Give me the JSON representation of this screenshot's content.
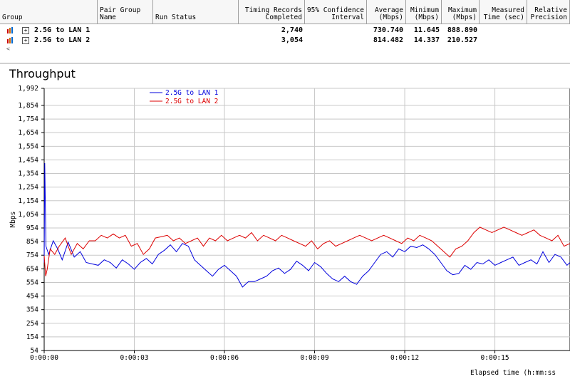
{
  "table": {
    "headers": [
      {
        "l1": "",
        "l2": "Group",
        "align": "left"
      },
      {
        "l1": "Pair Group",
        "l2": "Name",
        "align": "left"
      },
      {
        "l1": "",
        "l2": "Run Status",
        "align": "left"
      },
      {
        "l1": "Timing Records",
        "l2": "Completed",
        "align": "right"
      },
      {
        "l1": "95% Confidence",
        "l2": "Interval",
        "align": "right"
      },
      {
        "l1": "Average",
        "l2": "(Mbps)",
        "align": "right"
      },
      {
        "l1": "Minimum",
        "l2": "(Mbps)",
        "align": "right"
      },
      {
        "l1": "Maximum",
        "l2": "(Mbps)",
        "align": "right"
      },
      {
        "l1": "Measured",
        "l2": "Time (sec)",
        "align": "right"
      },
      {
        "l1": "Relative",
        "l2": "Precision",
        "align": "right"
      }
    ],
    "rows": [
      {
        "name": "2.5G to LAN 1",
        "records": "2,740",
        "average": "730.740",
        "minimum": "11.645",
        "maximum": "888.890"
      },
      {
        "name": "2.5G to LAN 2",
        "records": "3,054",
        "average": "814.482",
        "minimum": "14.337",
        "maximum": "210.527"
      }
    ],
    "expand_glyph": "+",
    "scroll_glyph": "<"
  },
  "chart_data": {
    "type": "line",
    "title": "Throughput",
    "ylabel": "Mbps",
    "xlabel": "Elapsed time (h:mm:ss",
    "ylim": [
      54,
      1992
    ],
    "yticks": [
      "1,992",
      "1,854",
      "1,754",
      "1,654",
      "1,554",
      "1,454",
      "1,354",
      "1,254",
      "1,154",
      "1,054",
      "954",
      "854",
      "754",
      "654",
      "554",
      "454",
      "354",
      "254",
      "154",
      "54"
    ],
    "ytick_values": [
      1992,
      1854,
      1754,
      1654,
      1554,
      1454,
      1354,
      1254,
      1154,
      1054,
      954,
      854,
      754,
      654,
      554,
      454,
      354,
      254,
      154,
      54
    ],
    "xlim": [
      0,
      17.5
    ],
    "xticks": [
      "0:00:00",
      "0:00:03",
      "0:00:06",
      "0:00:09",
      "0:00:12",
      "0:00:15"
    ],
    "xtick_values": [
      0,
      3,
      6,
      9,
      12,
      15
    ],
    "grid": true,
    "legend_position": "top-left",
    "series": [
      {
        "name": "2.5G to LAN 1",
        "color": "#0000dd",
        "x": [
          0,
          0.02,
          0.06,
          0.15,
          0.3,
          0.45,
          0.6,
          0.8,
          1.0,
          1.2,
          1.4,
          1.6,
          1.8,
          2.0,
          2.2,
          2.4,
          2.6,
          2.8,
          3.0,
          3.2,
          3.4,
          3.6,
          3.8,
          4.0,
          4.2,
          4.4,
          4.6,
          4.8,
          5.0,
          5.2,
          5.4,
          5.6,
          5.8,
          6.0,
          6.2,
          6.4,
          6.6,
          6.8,
          7.0,
          7.2,
          7.4,
          7.6,
          7.8,
          8.0,
          8.2,
          8.4,
          8.6,
          8.8,
          9.0,
          9.2,
          9.4,
          9.6,
          9.8,
          10.0,
          10.2,
          10.4,
          10.6,
          10.8,
          11.0,
          11.2,
          11.4,
          11.6,
          11.8,
          12.0,
          12.2,
          12.4,
          12.6,
          12.8,
          13.0,
          13.2,
          13.4,
          13.6,
          13.8,
          14.0,
          14.2,
          14.4,
          14.6,
          14.8,
          15.0,
          15.2,
          15.4,
          15.6,
          15.8,
          16.0,
          16.2,
          16.4,
          16.6,
          16.8,
          17.0,
          17.2,
          17.4,
          17.5
        ],
        "y": [
          700,
          1430,
          820,
          760,
          860,
          800,
          720,
          850,
          740,
          780,
          700,
          690,
          680,
          720,
          700,
          660,
          720,
          690,
          650,
          700,
          730,
          690,
          760,
          790,
          830,
          780,
          840,
          820,
          720,
          680,
          640,
          600,
          650,
          680,
          640,
          600,
          520,
          560,
          560,
          580,
          600,
          640,
          660,
          620,
          650,
          710,
          680,
          640,
          700,
          670,
          620,
          580,
          560,
          600,
          560,
          540,
          600,
          640,
          700,
          760,
          780,
          740,
          800,
          780,
          820,
          810,
          830,
          800,
          760,
          700,
          640,
          610,
          620,
          680,
          650,
          700,
          690,
          720,
          680,
          700,
          720,
          740,
          680,
          700,
          720,
          690,
          780,
          700,
          760,
          740,
          680,
          700
        ]
      },
      {
        "name": "2.5G to LAN 2",
        "color": "#dd0000",
        "x": [
          0,
          0.05,
          0.1,
          0.2,
          0.35,
          0.5,
          0.7,
          0.9,
          1.1,
          1.3,
          1.5,
          1.7,
          1.9,
          2.1,
          2.3,
          2.5,
          2.7,
          2.9,
          3.1,
          3.3,
          3.5,
          3.7,
          3.9,
          4.1,
          4.3,
          4.5,
          4.7,
          4.9,
          5.1,
          5.3,
          5.5,
          5.7,
          5.9,
          6.1,
          6.3,
          6.5,
          6.7,
          6.9,
          7.1,
          7.3,
          7.5,
          7.7,
          7.9,
          8.1,
          8.3,
          8.5,
          8.7,
          8.9,
          9.1,
          9.3,
          9.5,
          9.7,
          9.9,
          10.1,
          10.3,
          10.5,
          10.7,
          10.9,
          11.1,
          11.3,
          11.5,
          11.7,
          11.9,
          12.1,
          12.3,
          12.5,
          12.7,
          12.9,
          13.1,
          13.3,
          13.5,
          13.7,
          13.9,
          14.1,
          14.3,
          14.5,
          14.7,
          14.9,
          15.1,
          15.3,
          15.5,
          15.7,
          15.9,
          16.1,
          16.3,
          16.5,
          16.7,
          16.9,
          17.1,
          17.3,
          17.5
        ],
        "y": [
          750,
          600,
          650,
          800,
          760,
          820,
          880,
          760,
          840,
          800,
          860,
          860,
          900,
          880,
          910,
          880,
          900,
          820,
          840,
          760,
          800,
          880,
          890,
          900,
          860,
          880,
          840,
          860,
          880,
          820,
          880,
          860,
          900,
          860,
          880,
          900,
          880,
          920,
          860,
          900,
          880,
          860,
          900,
          880,
          860,
          840,
          820,
          860,
          800,
          840,
          860,
          820,
          840,
          860,
          880,
          900,
          880,
          860,
          880,
          900,
          880,
          860,
          840,
          880,
          860,
          900,
          880,
          860,
          820,
          780,
          740,
          800,
          820,
          860,
          920,
          960,
          940,
          920,
          940,
          960,
          940,
          920,
          900,
          920,
          940,
          900,
          880,
          860,
          900,
          820,
          840
        ]
      }
    ]
  }
}
